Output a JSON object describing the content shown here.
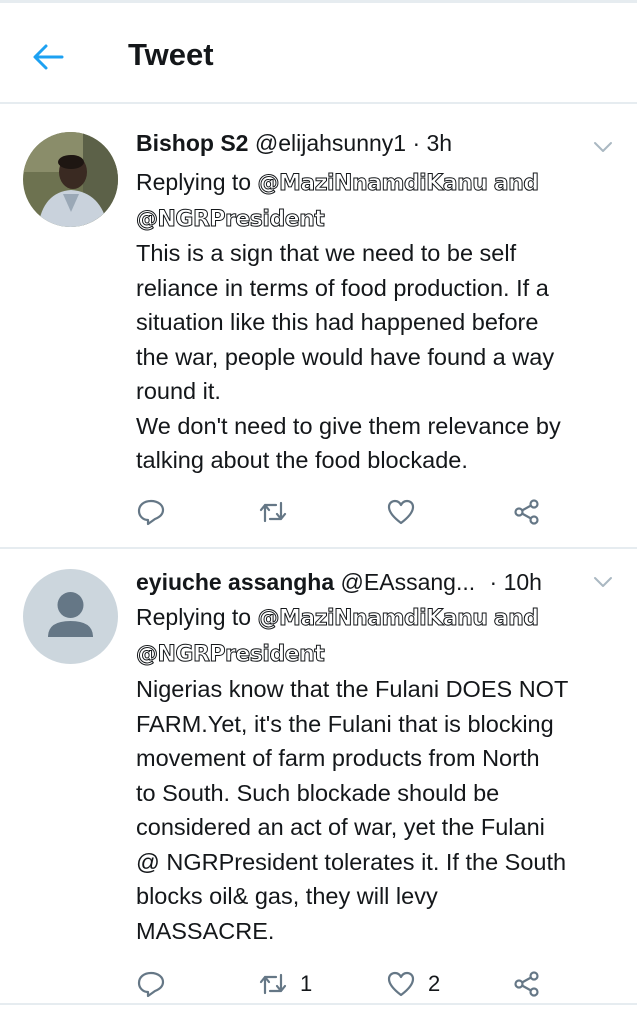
{
  "header": {
    "title": "Tweet"
  },
  "tweets": [
    {
      "display_name": "Bishop S2",
      "handle": "@elijahsunny1",
      "meta": "· 3h",
      "replying_prefix": "Replying to",
      "mention1": "@MaziNnamdiKanu",
      "and_word": "and",
      "mention2": "@NGRPresident",
      "text": "This is a sign that we need to be self\nreliance in terms of food production. If a\nsituation like this had happened before\nthe war, people would have found a way\nround it.\nWe don't need to give them relevance by\ntalking about the food blockade.",
      "retweet_count": "",
      "like_count": ""
    },
    {
      "display_name": "eyiuche assangha",
      "handle": "@EAssang...",
      "meta": "· 10h",
      "replying_prefix": "Replying to",
      "mention1": "@MaziNnamdiKanu",
      "and_word": "and",
      "mention2": "@NGRPresident",
      "text": "Nigerias know that the Fulani DOES NOT\nFARM.Yet, it's the Fulani that is blocking\nmovement of farm products from North\nto South. Such blockade should be\nconsidered an act of war, yet the Fulani\n@ NGRPresident tolerates it. If the South\nblocks oil& gas, they will levy\nMASSACRE.",
      "retweet_count": "1",
      "like_count": "2"
    }
  ],
  "colors": {
    "accent": "#1da1f2",
    "icon_gray": "#657786",
    "separator": "#e6ecf0"
  },
  "icons": [
    "back-arrow-icon",
    "chevron-down-icon",
    "reply-icon",
    "retweet-icon",
    "like-icon",
    "share-icon"
  ]
}
